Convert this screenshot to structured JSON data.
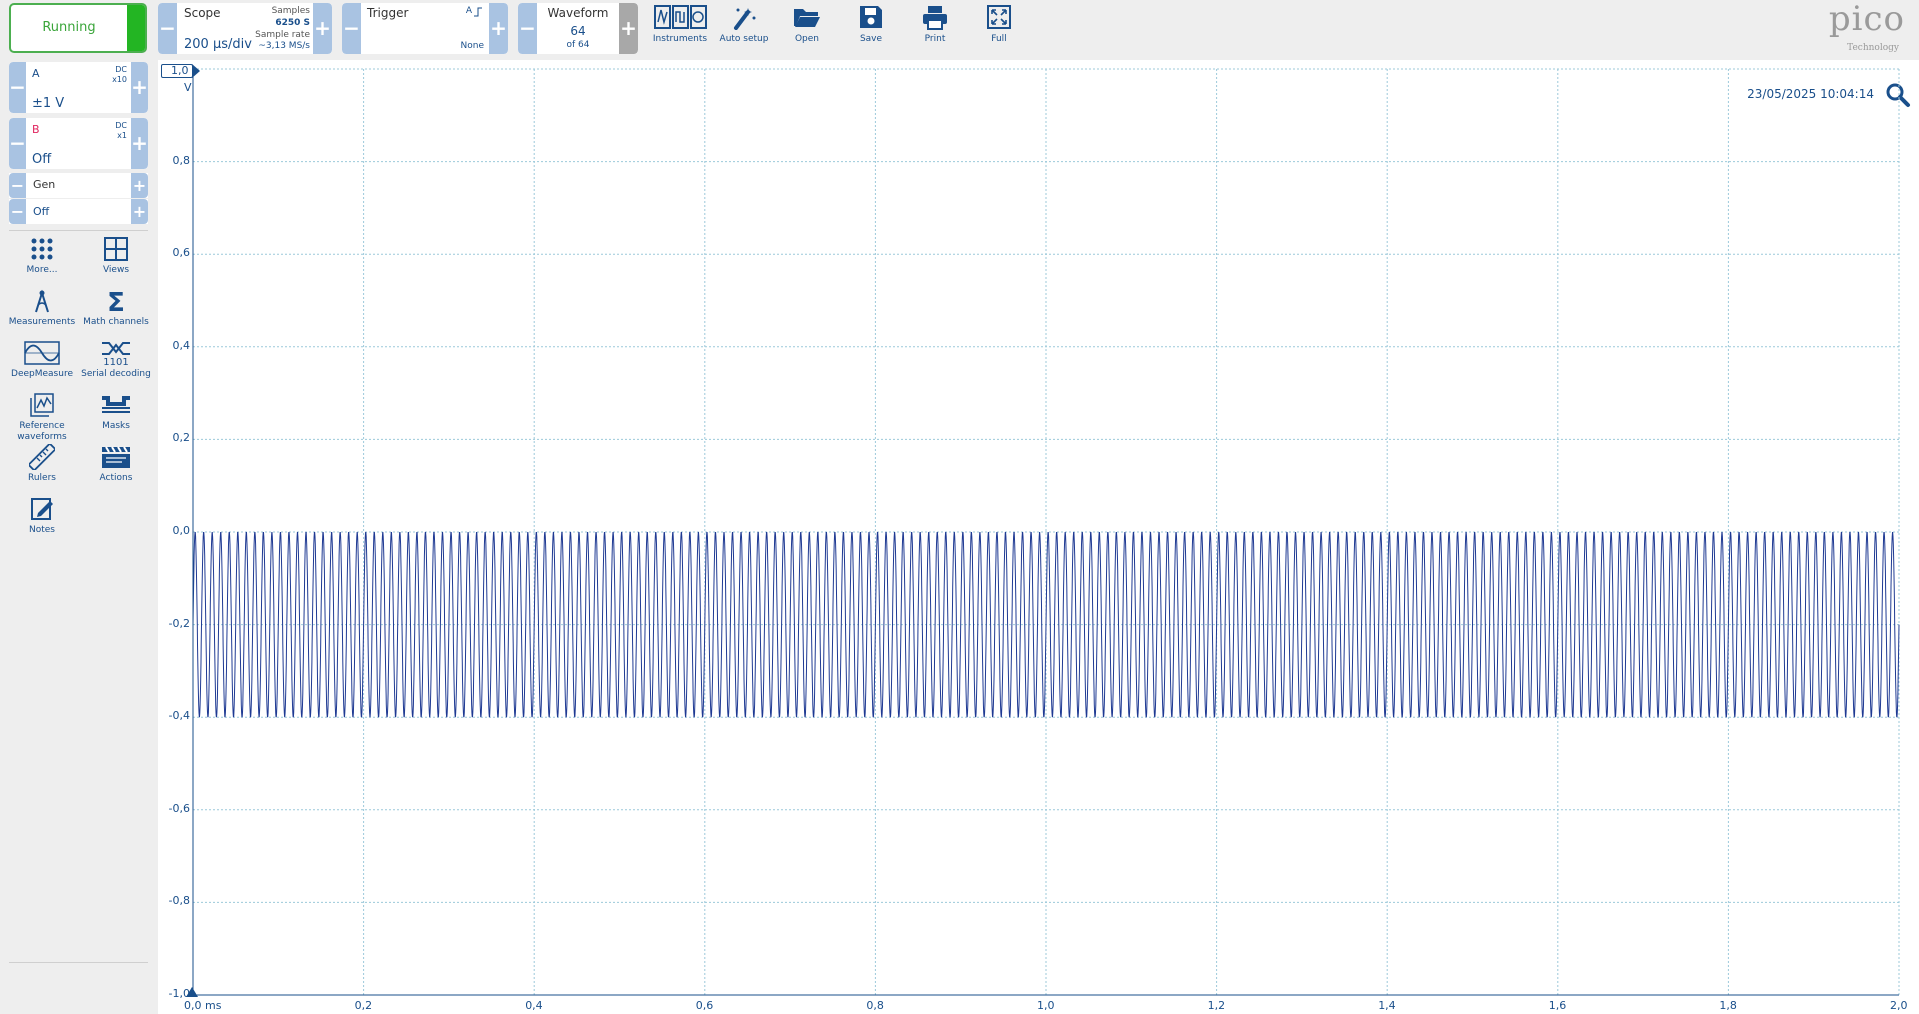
{
  "toolbar": {
    "running_label": "Running",
    "scope": {
      "title": "Scope",
      "timebase": "200 µs/div",
      "samples_label": "Samples",
      "samples_value": "6250 S",
      "rate_label": "Sample rate",
      "rate_value": "~3,13 MS/s"
    },
    "trigger": {
      "title": "Trigger",
      "source": "A",
      "mode": "None"
    },
    "waveform": {
      "title": "Waveform",
      "index": "64",
      "of": "of 64"
    },
    "buttons": [
      {
        "label": "Instruments",
        "icon": "instruments-icon"
      },
      {
        "label": "Auto setup",
        "icon": "auto-setup-icon"
      },
      {
        "label": "Open",
        "icon": "folder-open-icon"
      },
      {
        "label": "Save",
        "icon": "save-icon"
      },
      {
        "label": "Print",
        "icon": "print-icon"
      },
      {
        "label": "Full",
        "icon": "fullscreen-icon"
      }
    ],
    "logo": {
      "brand": "pico",
      "sub": "Technology"
    }
  },
  "channels": [
    {
      "name": "A",
      "coupling": "DC",
      "probe": "x10",
      "range": "±1 V",
      "color": "#1a4f8b"
    },
    {
      "name": "B",
      "coupling": "DC",
      "probe": "x1",
      "range": "Off",
      "color": "#e0245e"
    }
  ],
  "generator": {
    "label": "Gen",
    "value": "Off"
  },
  "tools": [
    {
      "label": "More...",
      "icon": "more-dots-icon"
    },
    {
      "label": "Views",
      "icon": "views-grid-icon"
    },
    {
      "label": "Measurements",
      "icon": "measurements-icon"
    },
    {
      "label": "Math channels",
      "icon": "sigma-icon"
    },
    {
      "label": "DeepMeasure",
      "icon": "deepmeasure-icon"
    },
    {
      "label": "Serial decoding",
      "icon": "serial-decoding-icon"
    },
    {
      "label": "Reference waveforms",
      "icon": "reference-waveforms-icon"
    },
    {
      "label": "Masks",
      "icon": "masks-icon"
    },
    {
      "label": "Rulers",
      "icon": "ruler-icon"
    },
    {
      "label": "Actions",
      "icon": "clapper-icon"
    },
    {
      "label": "Notes",
      "icon": "notes-icon"
    }
  ],
  "plot": {
    "timestamp": "23/05/2025 10:04:14",
    "y_unit": "V",
    "y_top_label": "1,0",
    "y_ticks": [
      "0,8",
      "0,6",
      "0,4",
      "0,2",
      "0,0",
      "-0,2",
      "-0,4",
      "-0,6",
      "-0,8",
      "-1,0"
    ],
    "x_ticks": [
      "0,0 ms",
      "0,2",
      "0,4",
      "0,6",
      "0,8",
      "1,0",
      "1,2",
      "1,4",
      "1,6",
      "1,8",
      "2,0"
    ],
    "trace_color": "#1f3a93"
  },
  "chart_data": {
    "type": "line",
    "title": "",
    "xlabel": "ms",
    "ylabel": "V",
    "xlim": [
      0,
      2.0
    ],
    "ylim": [
      -1.0,
      1.0
    ],
    "grid": true,
    "series": [
      {
        "name": "A",
        "signal": "periodic oscillation",
        "min": -0.4,
        "max": 0.0,
        "cycles": 200
      }
    ]
  }
}
